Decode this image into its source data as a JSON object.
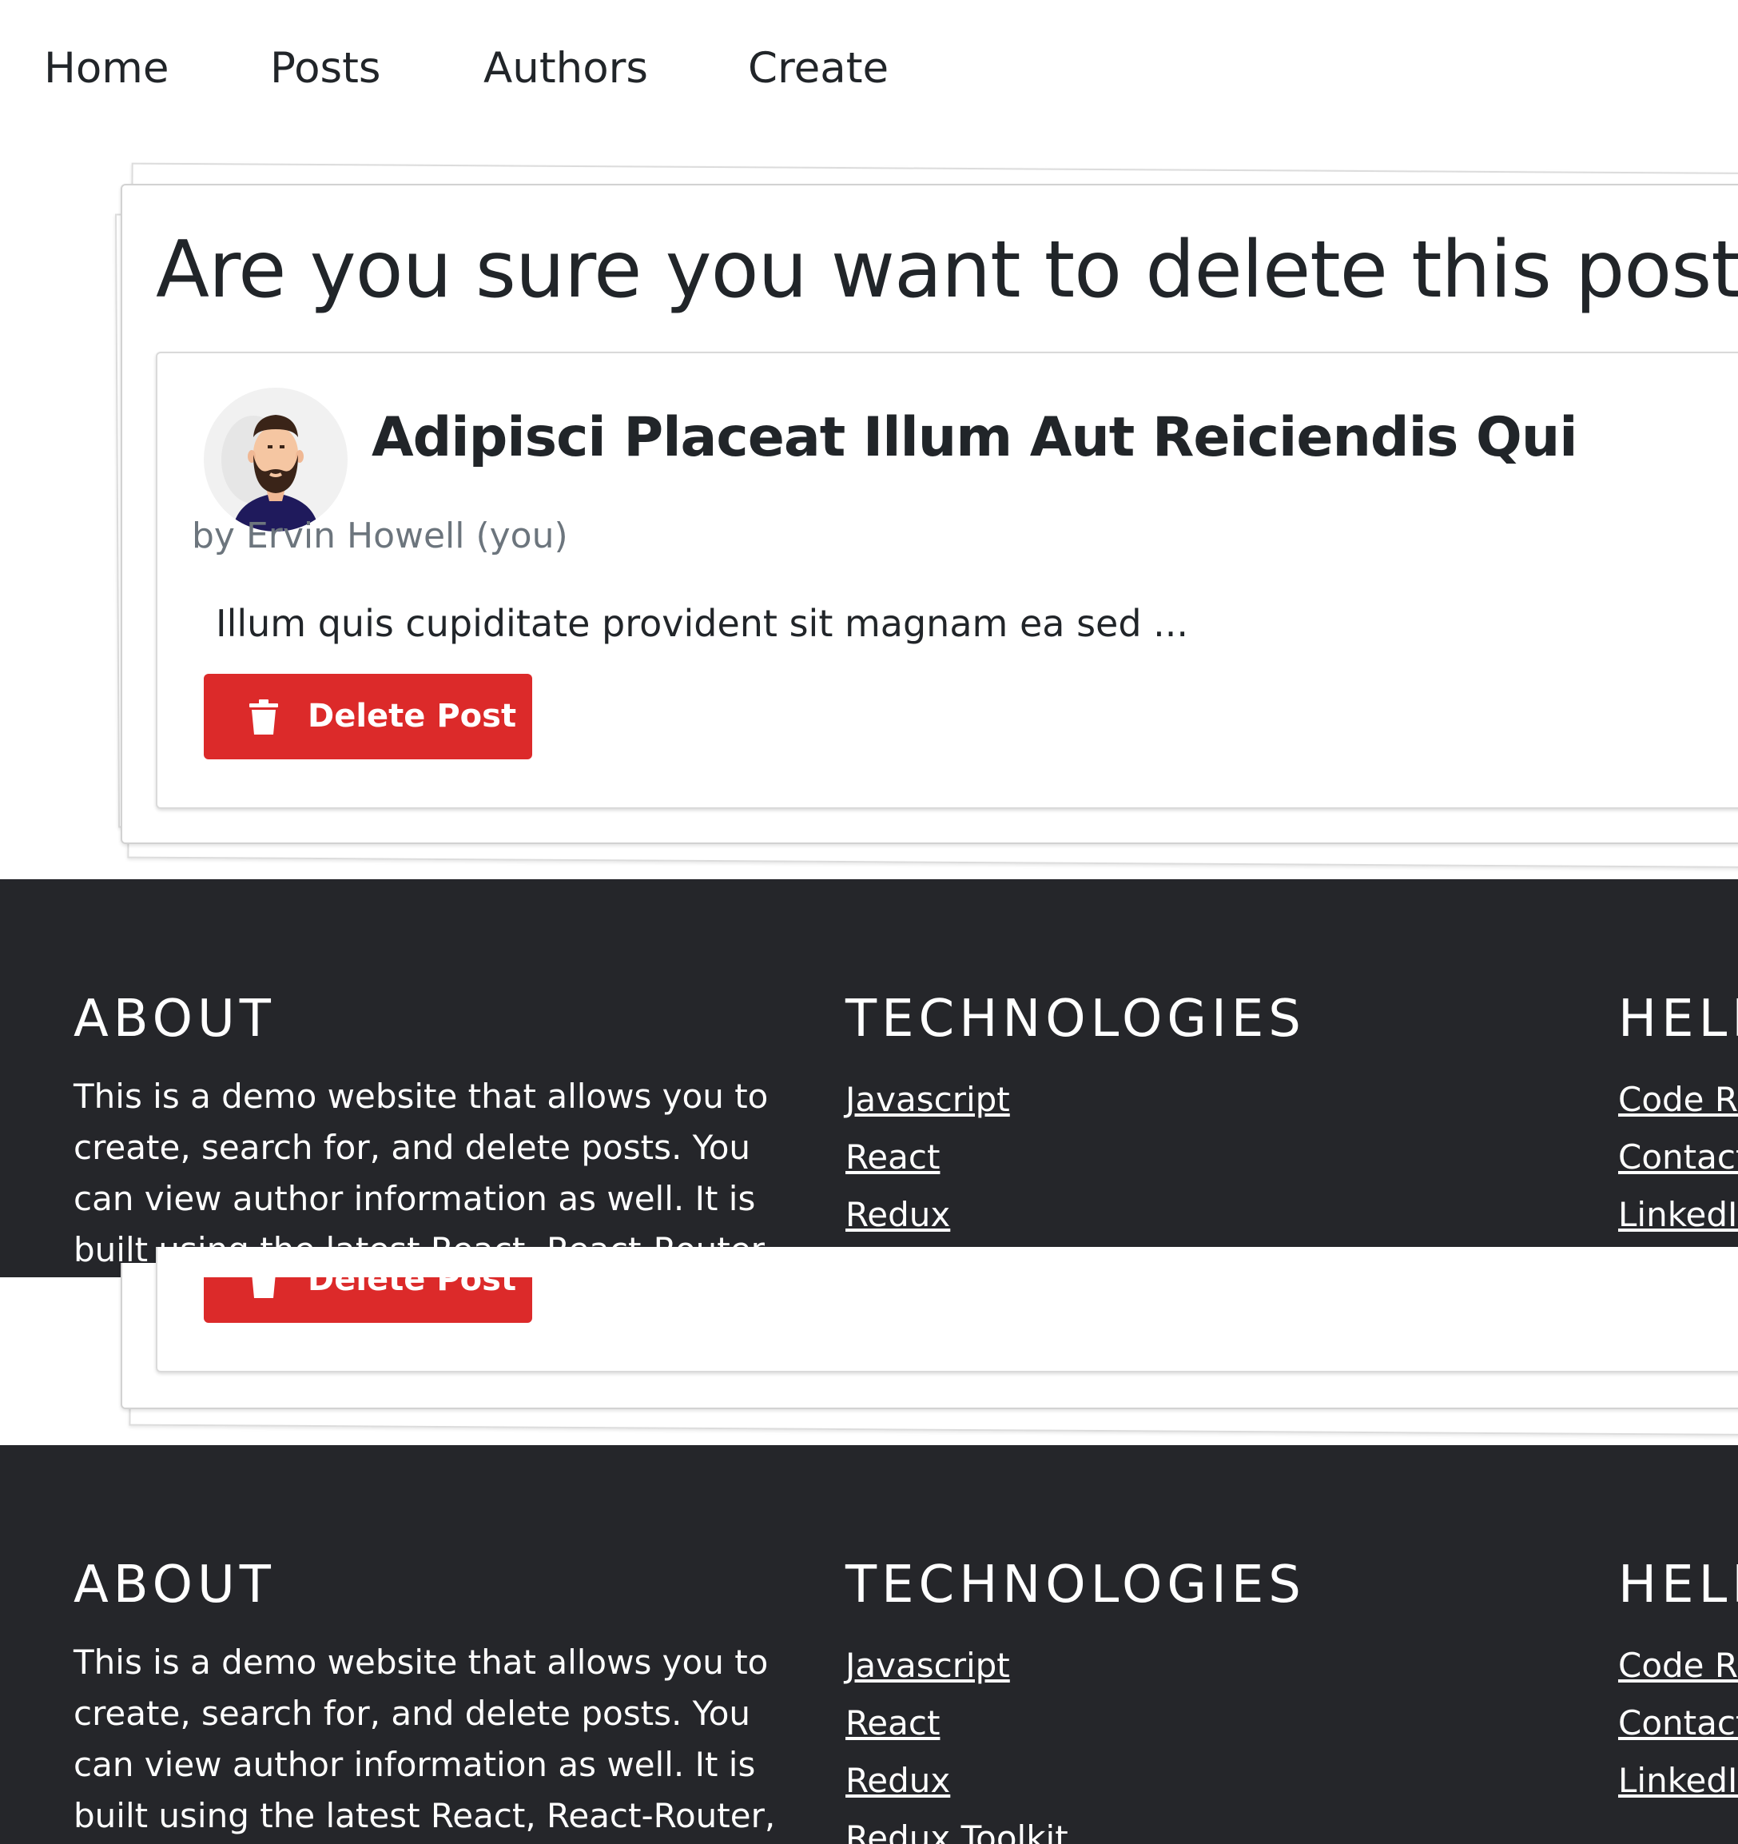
{
  "nav": {
    "items": [
      {
        "label": "Home"
      },
      {
        "label": "Posts"
      },
      {
        "label": "Authors"
      },
      {
        "label": "Create"
      }
    ]
  },
  "confirm": {
    "heading": "Are you sure you want to delete this post?"
  },
  "post": {
    "title": "Adipisci Placeat Illum Aut Reiciendis Qui",
    "byline": "by Ervin Howell (you)",
    "excerpt": "Illum quis cupiditate provident sit magnam ea sed ...",
    "delete_label": "Delete Post"
  },
  "footer": {
    "about_heading": "ABOUT",
    "about_text": "This is a demo website that allows you to create, search for, and delete posts. You can view author information as well. It is built using the latest React, React-Router, Redux,",
    "tech_heading": "TECHNOLOGIES",
    "tech_links": [
      {
        "label": "Javascript"
      },
      {
        "label": "React"
      },
      {
        "label": "Redux"
      },
      {
        "label": "Redux Toolkit"
      }
    ],
    "help_heading": "HELP",
    "help_links": [
      {
        "label": "Code Repository"
      },
      {
        "label": "Contact"
      },
      {
        "label": "LinkedIn"
      }
    ]
  },
  "colors": {
    "footer_bg": "#25262a",
    "danger": "#dc2a2a",
    "muted_text": "#6c757d"
  },
  "icons": {
    "delete": "trash-icon",
    "avatar": "bearded-man-avatar"
  }
}
